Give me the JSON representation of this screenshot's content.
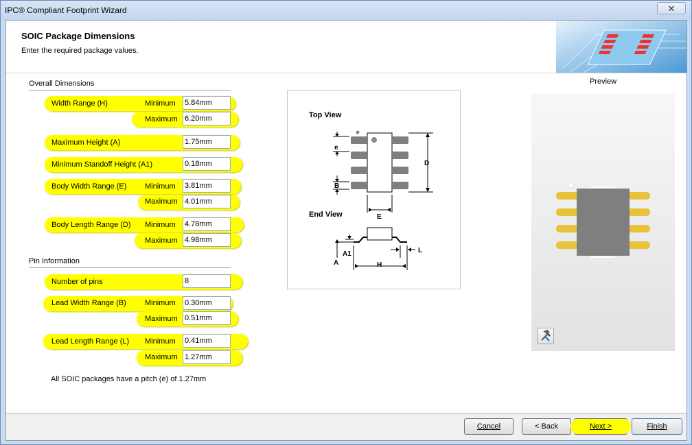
{
  "window": {
    "title": "IPC® Compliant Footprint Wizard"
  },
  "header": {
    "title": "SOIC Package Dimensions",
    "subtitle": "Enter the required package values."
  },
  "sections": {
    "overall": "Overall Dimensions",
    "pins": "Pin Information"
  },
  "fields": {
    "width_range": {
      "label": "Width Range (H)",
      "min_label": "Minimum",
      "min": "5.84mm",
      "max_label": "Maximum",
      "max": "6.20mm"
    },
    "max_height": {
      "label": "Maximum Height (A)",
      "value": "1.75mm"
    },
    "min_standoff": {
      "label": "Minimum Standoff Height (A1)",
      "value": "0.18mm"
    },
    "body_width": {
      "label": "Body Width Range (E)",
      "min_label": "Minimum",
      "min": "3.81mm",
      "max_label": "Maximum",
      "max": "4.01mm"
    },
    "body_length": {
      "label": "Body Length Range (D)",
      "min_label": "Minimum",
      "min": "4.78mm",
      "max_label": "Maximum",
      "max": "4.98mm"
    },
    "num_pins": {
      "label": "Number of pins",
      "value": "8"
    },
    "lead_width": {
      "label": "Lead Width Range (B)",
      "min_label": "Minimum",
      "min": "0.30mm",
      "max_label": "Maximum",
      "max": "0.51mm"
    },
    "lead_length": {
      "label": "Lead Length Range (L)",
      "min_label": "Minimum",
      "min": "0.41mm",
      "max_label": "Maximum",
      "max": "1.27mm"
    }
  },
  "footnote": "All SOIC packages have a pitch (e) of 1.27mm",
  "diagram": {
    "top_view": "Top View",
    "end_view": "End View",
    "labels": {
      "e": "e",
      "B": "B",
      "D": "D",
      "E": "E",
      "A1": "A1",
      "A": "A",
      "H": "H",
      "L": "L"
    }
  },
  "preview": {
    "label": "Preview",
    "tool_icon": "wrench-hammer-icon"
  },
  "buttons": {
    "cancel": "Cancel",
    "back": "< Back",
    "next": "Next >",
    "finish": "Finish"
  },
  "colors": {
    "highlight": "#ffff00",
    "lead": "#e8c23a",
    "body": "#7f7f7f"
  }
}
